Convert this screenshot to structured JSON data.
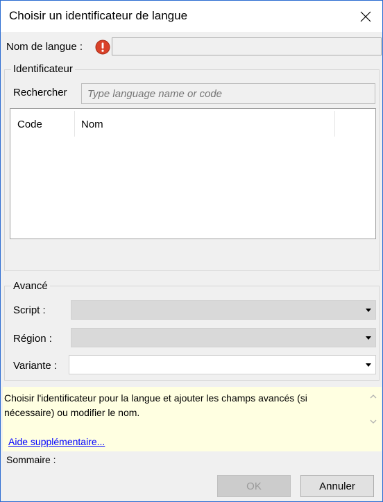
{
  "dialog": {
    "title": "Choisir un identificateur de langue"
  },
  "language_name": {
    "label": "Nom de langue :",
    "value": ""
  },
  "identifier": {
    "legend": "Identificateur",
    "search_label": "Rechercher",
    "search_placeholder": "Type language name or code",
    "columns": [
      "Code",
      "Nom"
    ],
    "rows": []
  },
  "advanced": {
    "legend": "Avancé",
    "script_label": "Script :",
    "script_value": "",
    "region_label": "Région :",
    "region_value": "",
    "variant_label": "Variante :",
    "variant_value": ""
  },
  "info": {
    "text": "Choisir l'identificateur pour la langue et ajouter les champs avancés (si nécessaire) ou modifier le nom.",
    "help_link": "Aide supplémentaire..."
  },
  "summary": {
    "label": "Sommaire :"
  },
  "buttons": {
    "ok": "OK",
    "cancel": "Annuler"
  }
}
